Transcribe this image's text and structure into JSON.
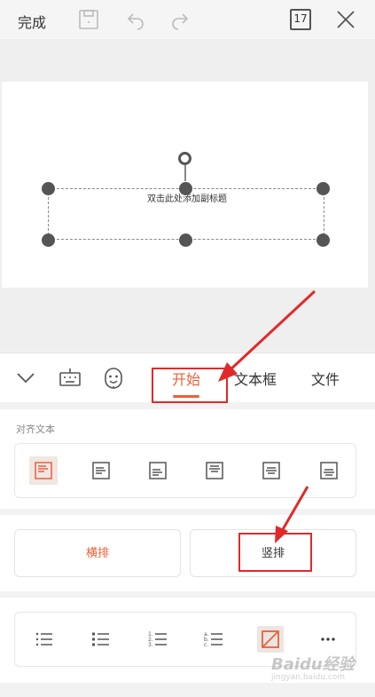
{
  "topbar": {
    "done_label": "完成",
    "save_icon": "save-icon",
    "undo_icon": "undo-icon",
    "redo_icon": "redo-icon",
    "page_count": "17",
    "close_icon": "close-icon"
  },
  "slide": {
    "subtitle_placeholder": "双击此处添加副标题"
  },
  "tabbar": {
    "collapse_icon": "chevron-down-icon",
    "keyboard_icon": "keyboard-icon",
    "emoji_icon": "emoji-icon",
    "tabs": [
      {
        "label": "开始",
        "active": true
      },
      {
        "label": "文本框",
        "active": false
      },
      {
        "label": "文件",
        "active": false
      }
    ],
    "accent_color": "#e8613a"
  },
  "align_section": {
    "title": "对齐文本",
    "buttons": [
      {
        "icon": "align-top-left-icon",
        "selected": true
      },
      {
        "icon": "align-middle-left-icon",
        "selected": false
      },
      {
        "icon": "align-bottom-left-icon",
        "selected": false
      },
      {
        "icon": "align-top-center-icon",
        "selected": false
      },
      {
        "icon": "align-middle-center-icon",
        "selected": false
      },
      {
        "icon": "align-bottom-center-icon",
        "selected": false
      }
    ]
  },
  "direction_section": {
    "horizontal_label": "横排",
    "vertical_label": "竖排",
    "horizontal_selected": true
  },
  "list_section": {
    "buttons": [
      {
        "icon": "bullet-list-icon",
        "selected": false
      },
      {
        "icon": "filled-bullet-list-icon",
        "selected": false
      },
      {
        "icon": "numbered-list-icon",
        "selected": false
      },
      {
        "icon": "lettered-list-icon",
        "selected": false
      },
      {
        "icon": "no-list-icon",
        "selected": true
      },
      {
        "icon": "more-icon",
        "selected": false
      }
    ]
  },
  "watermark": {
    "brand": "Baidu经验",
    "url": "jingyan.baidu.com"
  }
}
